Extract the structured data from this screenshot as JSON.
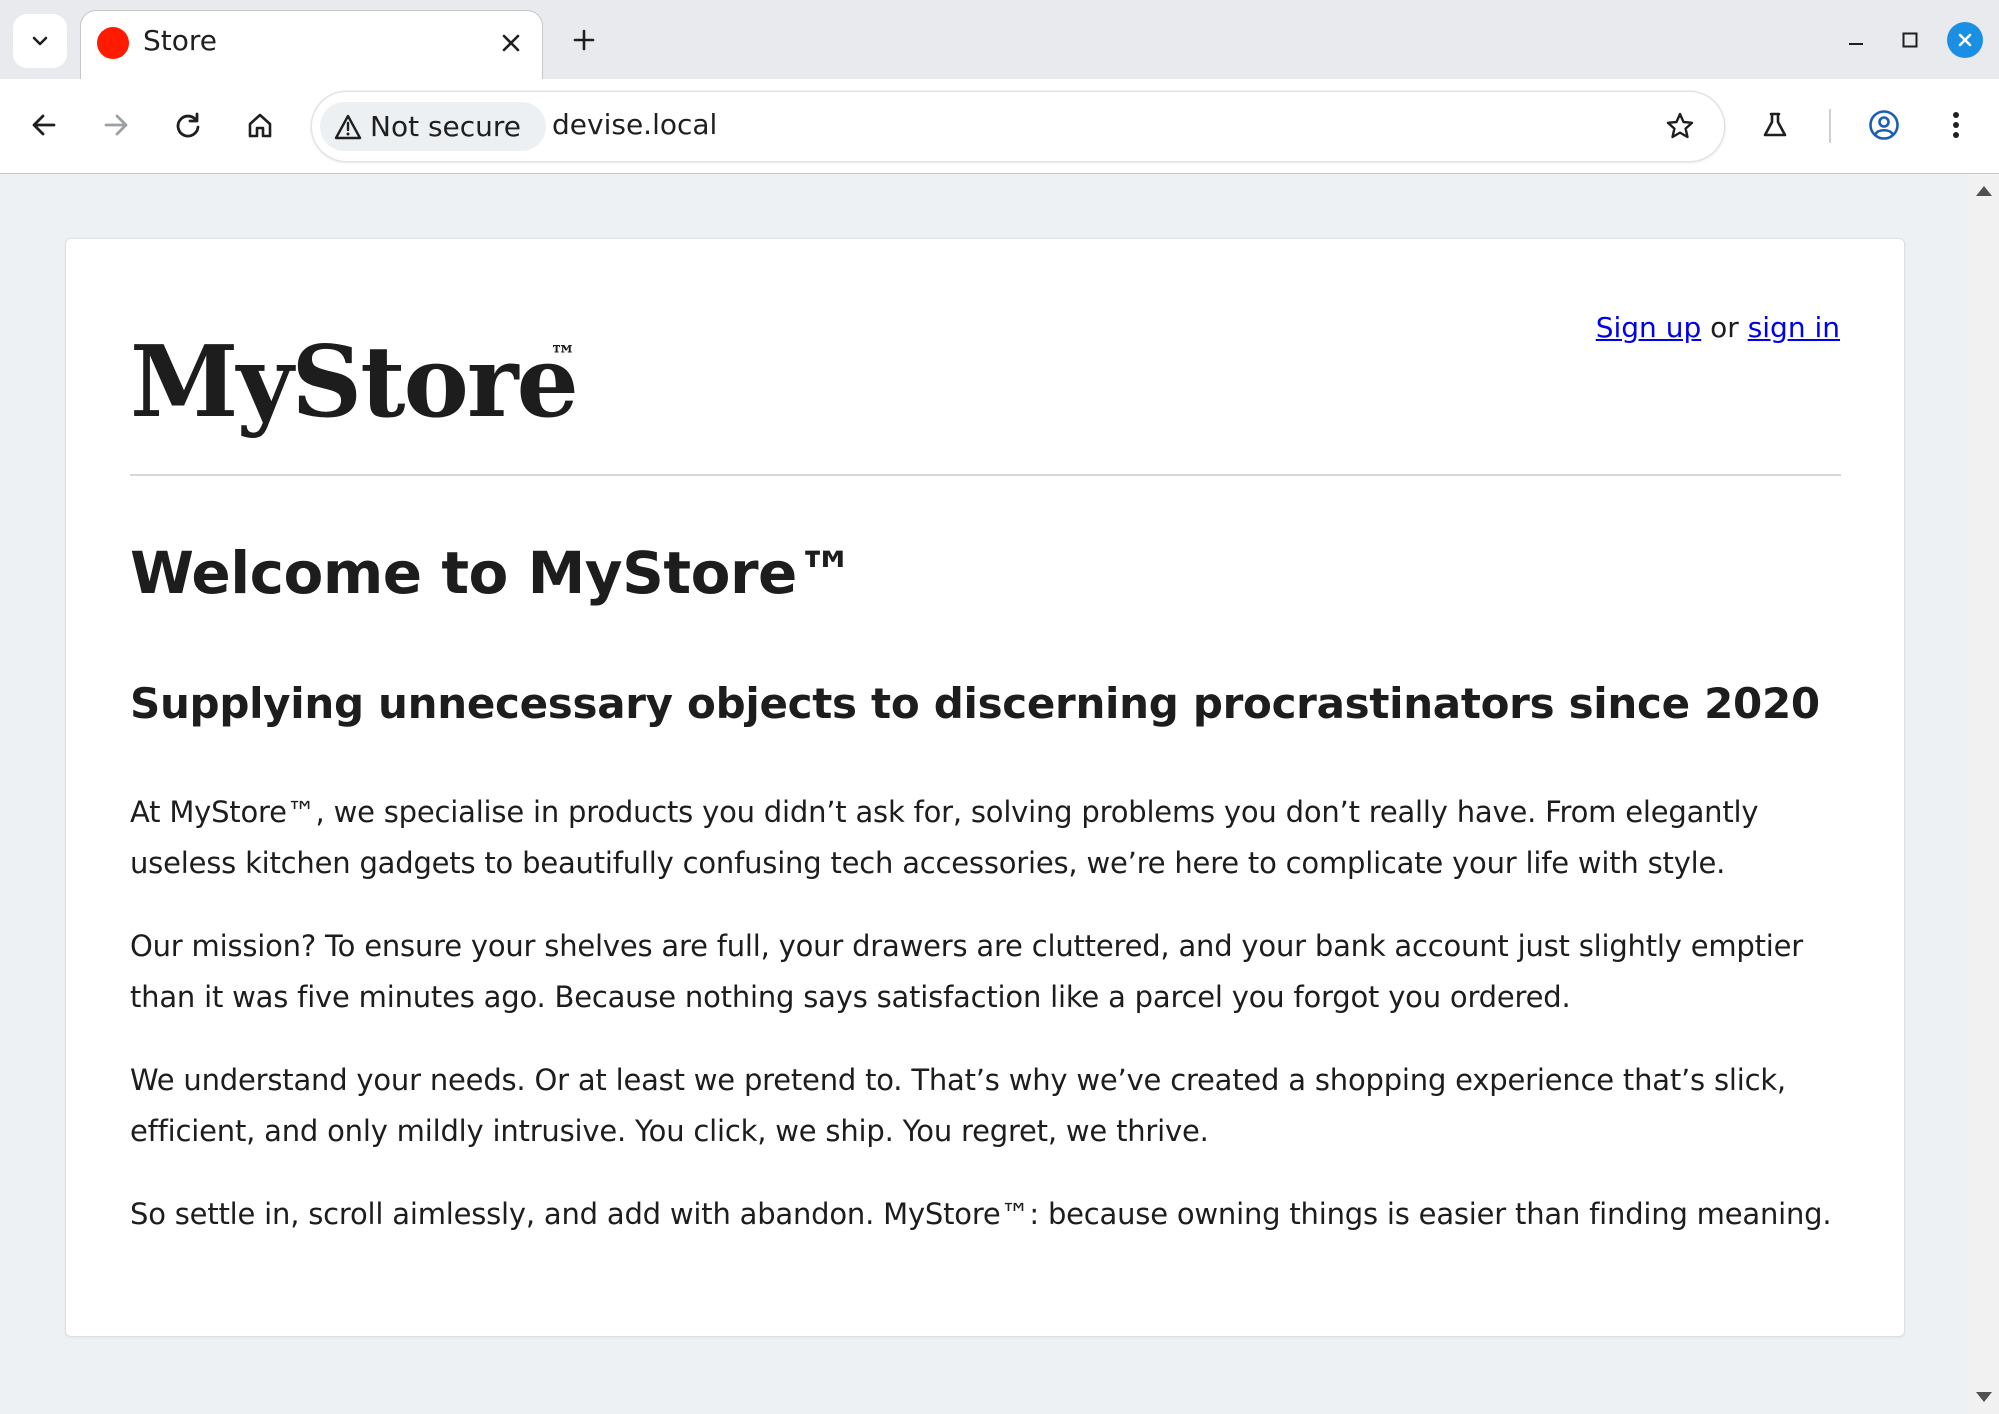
{
  "browser": {
    "tab": {
      "title": "Store"
    },
    "omnibox": {
      "security_chip": "Not secure",
      "url": "devise.local"
    }
  },
  "page": {
    "logo": "MyStore",
    "logo_mark": "™",
    "auth": {
      "sign_up": "Sign up",
      "connector": "or",
      "sign_in": "sign in"
    },
    "heading": "Welcome to MyStore™",
    "subheading": "Supplying unnecessary objects to discerning procrastinators since 2020",
    "paragraphs": [
      "At MyStore™, we specialise in products you didn’t ask for, solving problems you don’t really have. From elegantly useless kitchen gadgets to beautifully confusing tech accessories, we’re here to complicate your life with style.",
      "Our mission? To ensure your shelves are full, your drawers are cluttered, and your bank account just slightly emptier than it was five minutes ago. Because nothing says satisfaction like a parcel you forgot you ordered.",
      "We understand your needs. Or at least we pretend to. That’s why we’ve created a shopping experience that’s slick, efficient, and only mildly intrusive. You click, we ship. You regret, we thrive.",
      "So settle in, scroll aimlessly, and add with abandon. MyStore™: because owning things is easier than finding meaning."
    ]
  }
}
